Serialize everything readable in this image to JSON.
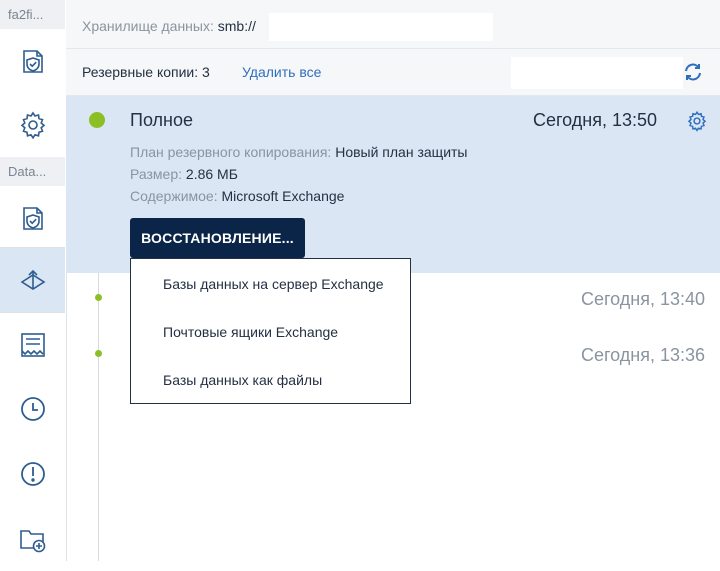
{
  "sidebar": {
    "machine_label": "fa2fi...",
    "data_label": "Data...",
    "icons": [
      "protection-plan-icon",
      "settings-gear-icon",
      "protection-plan-icon",
      "recovery-icon",
      "activities-icon",
      "history-clock-icon",
      "alerts-icon",
      "add-folder-icon"
    ]
  },
  "storage": {
    "label": "Хранилище данных:",
    "value": "smb://"
  },
  "backups": {
    "count_label": "Резервные копии: 3",
    "delete_all": "Удалить все"
  },
  "selected_backup": {
    "title": "Полное",
    "time": "Сегодня, 13:50",
    "plan_label": "План резервного копирования:",
    "plan_value": "Новый план защиты",
    "size_label": "Размер:",
    "size_value": "2.86 МБ",
    "content_label": "Содержимое:",
    "content_value": "Microsoft Exchange",
    "restore_button": "ВОССТАНОВЛЕНИЕ..."
  },
  "other_backups": [
    {
      "time": "Сегодня, 13:40"
    },
    {
      "time": "Сегодня, 13:36"
    }
  ],
  "restore_menu": [
    "Базы данных на сервер Exchange",
    "Почтовые ящики Exchange",
    "Базы данных как файлы"
  ],
  "colors": {
    "accent_blue": "#2f6ebd",
    "dark_navy": "#0b2548",
    "selected_bg": "#dbe6f5",
    "status_green": "#8cbf26"
  }
}
